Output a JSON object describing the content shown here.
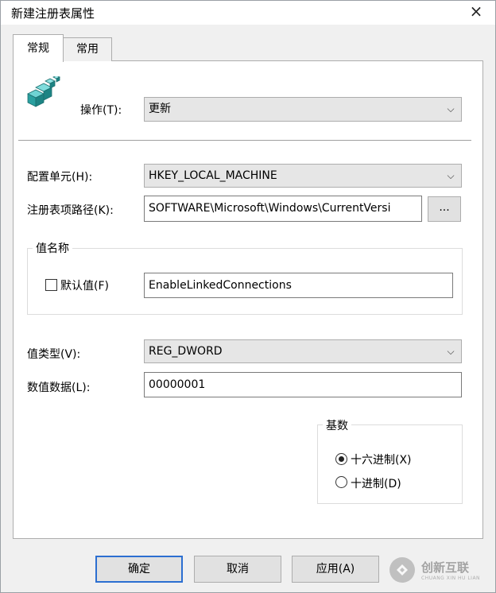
{
  "window": {
    "title": "新建注册表属性",
    "close_label": "×"
  },
  "tabs": [
    {
      "label": "常规",
      "active": true
    },
    {
      "label": "常用",
      "active": false
    }
  ],
  "general": {
    "action_label": "操作(T):",
    "action_value": "更新",
    "hive_label": "配置单元(H):",
    "hive_value": "HKEY_LOCAL_MACHINE",
    "keypath_label": "注册表项路径(K):",
    "keypath_value": "SOFTWARE\\Microsoft\\Windows\\CurrentVersi",
    "browse_label": "...",
    "value_name_group": "值名称",
    "default_checkbox_label": "默认值(F)",
    "default_checked": false,
    "value_name": "EnableLinkedConnections",
    "value_type_label": "值类型(V):",
    "value_type": "REG_DWORD",
    "value_data_label": "数值数据(L):",
    "value_data": "00000001",
    "base_group": "基数",
    "radix_options": [
      {
        "label": "十六进制(X)",
        "selected": true
      },
      {
        "label": "十进制(D)",
        "selected": false
      }
    ]
  },
  "buttons": {
    "ok": "确定",
    "cancel": "取消",
    "apply": "应用(A)"
  },
  "watermark": {
    "text": "创新互联",
    "sub": "CHUANG XIN HU LIAN"
  }
}
